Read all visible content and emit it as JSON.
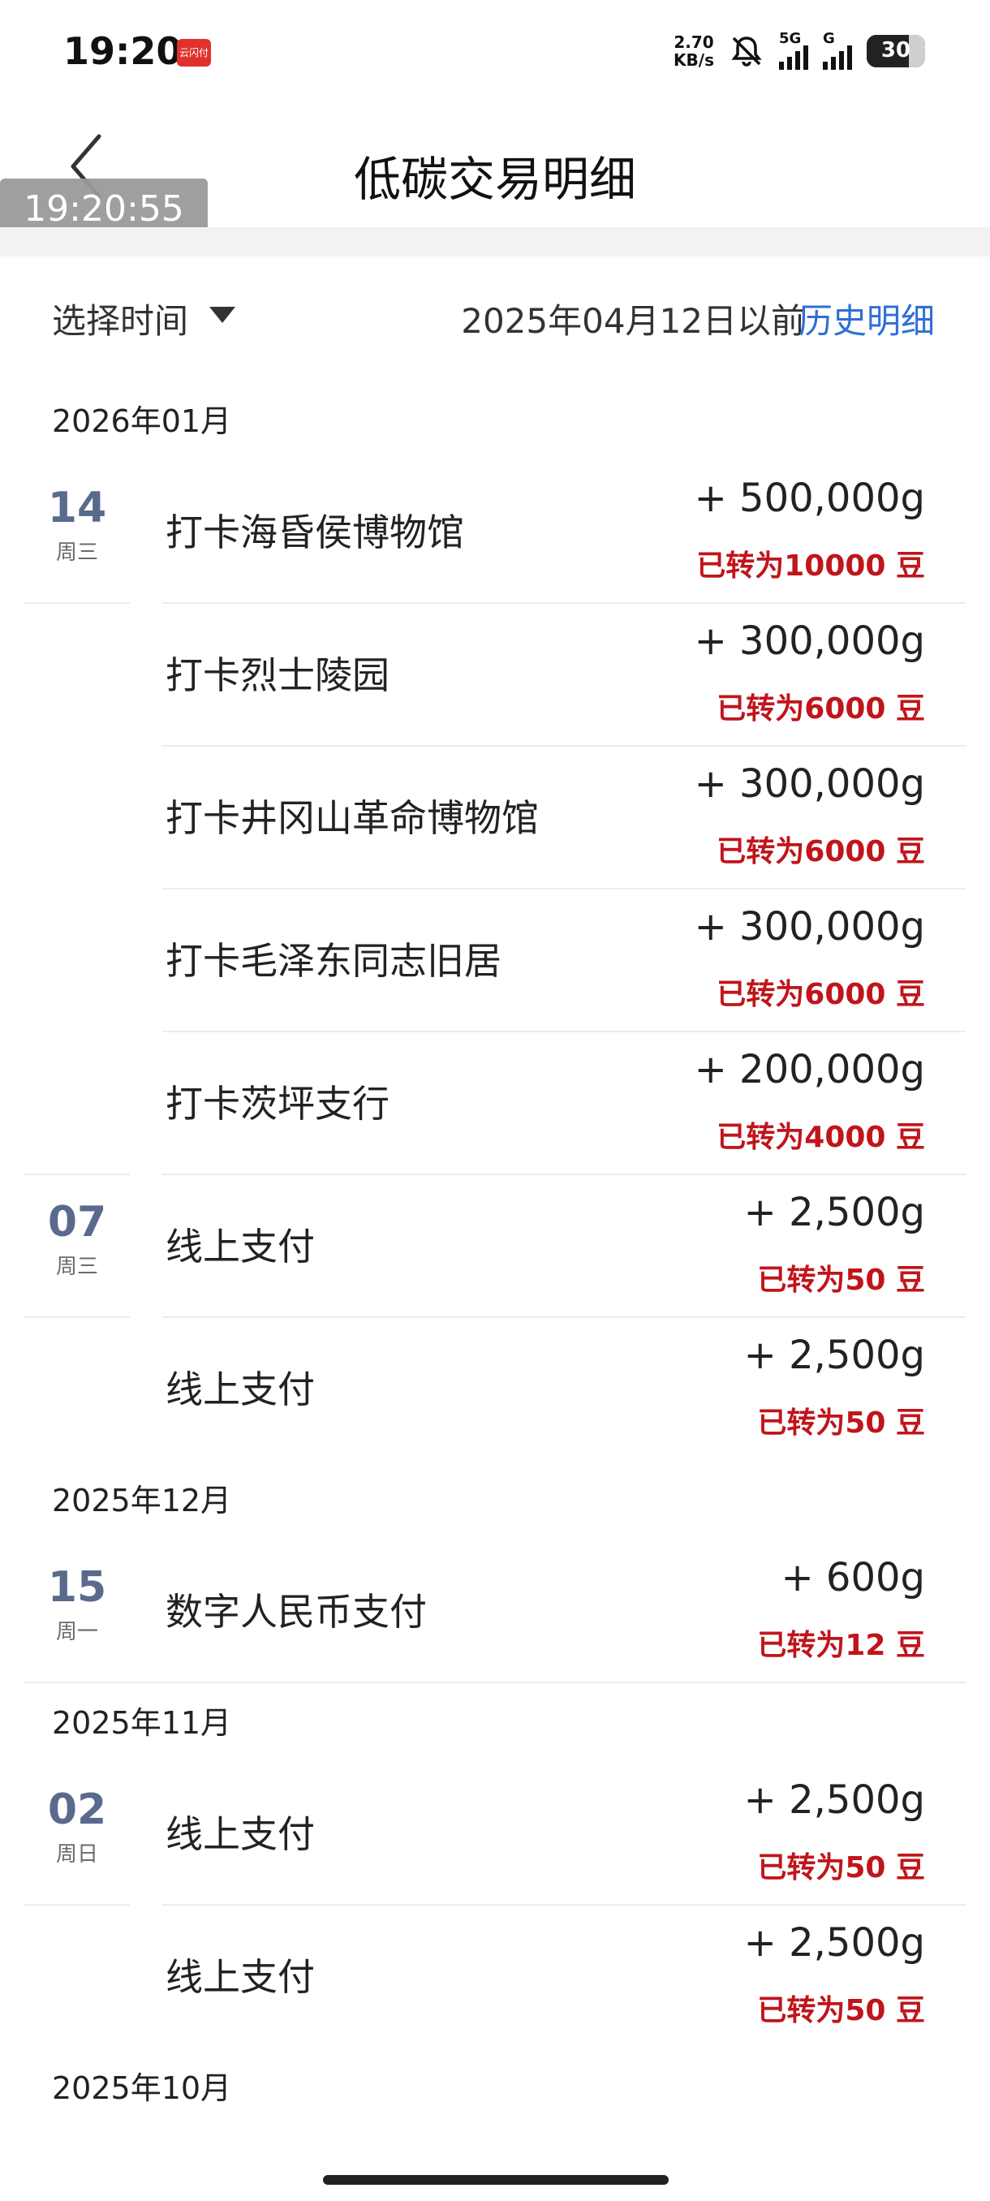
{
  "status_bar": {
    "time": "19:20",
    "app_badge": "云闪付",
    "net_speed_value": "2.70",
    "net_speed_unit": "KB/s",
    "sig1_label": "5G",
    "sig2_label": "G",
    "battery": "30"
  },
  "header": {
    "title": "低碳交易明细",
    "overlay_time": "19:20:55"
  },
  "filter": {
    "select_label": "选择时间",
    "before_text": "2025年04月12日以前",
    "history_link": "历史明细"
  },
  "months": [
    {
      "label": "2026年01月",
      "rows": [
        {
          "day": "14",
          "weekday": "周三",
          "desc": "打卡海昏侯博物馆",
          "amount": "+ 500,000g",
          "beans": "已转为10000 豆"
        },
        {
          "day": "",
          "weekday": "",
          "desc": "打卡烈士陵园",
          "amount": "+ 300,000g",
          "beans": "已转为6000 豆"
        },
        {
          "day": "",
          "weekday": "",
          "desc": "打卡井冈山革命博物馆",
          "amount": "+ 300,000g",
          "beans": "已转为6000 豆"
        },
        {
          "day": "",
          "weekday": "",
          "desc": "打卡毛泽东同志旧居",
          "amount": "+ 300,000g",
          "beans": "已转为6000 豆"
        },
        {
          "day": "",
          "weekday": "",
          "desc": "打卡茨坪支行",
          "amount": "+ 200,000g",
          "beans": "已转为4000 豆"
        },
        {
          "day": "07",
          "weekday": "周三",
          "desc": "线上支付",
          "amount": "+ 2,500g",
          "beans": "已转为50 豆"
        },
        {
          "day": "",
          "weekday": "",
          "desc": "线上支付",
          "amount": "+ 2,500g",
          "beans": "已转为50 豆"
        }
      ]
    },
    {
      "label": "2025年12月",
      "rows": [
        {
          "day": "15",
          "weekday": "周一",
          "desc": "数字人民币支付",
          "amount": "+ 600g",
          "beans": "已转为12 豆"
        }
      ]
    },
    {
      "label": "2025年11月",
      "rows": [
        {
          "day": "02",
          "weekday": "周日",
          "desc": "线上支付",
          "amount": "+ 2,500g",
          "beans": "已转为50 豆"
        },
        {
          "day": "",
          "weekday": "",
          "desc": "线上支付",
          "amount": "+ 2,500g",
          "beans": "已转为50 豆"
        }
      ]
    },
    {
      "label": "2025年10月",
      "rows": []
    }
  ],
  "colors": {
    "accent_link": "#2f6fd6",
    "beans_red": "#c0151b",
    "date_slate": "#5a6a8c"
  }
}
